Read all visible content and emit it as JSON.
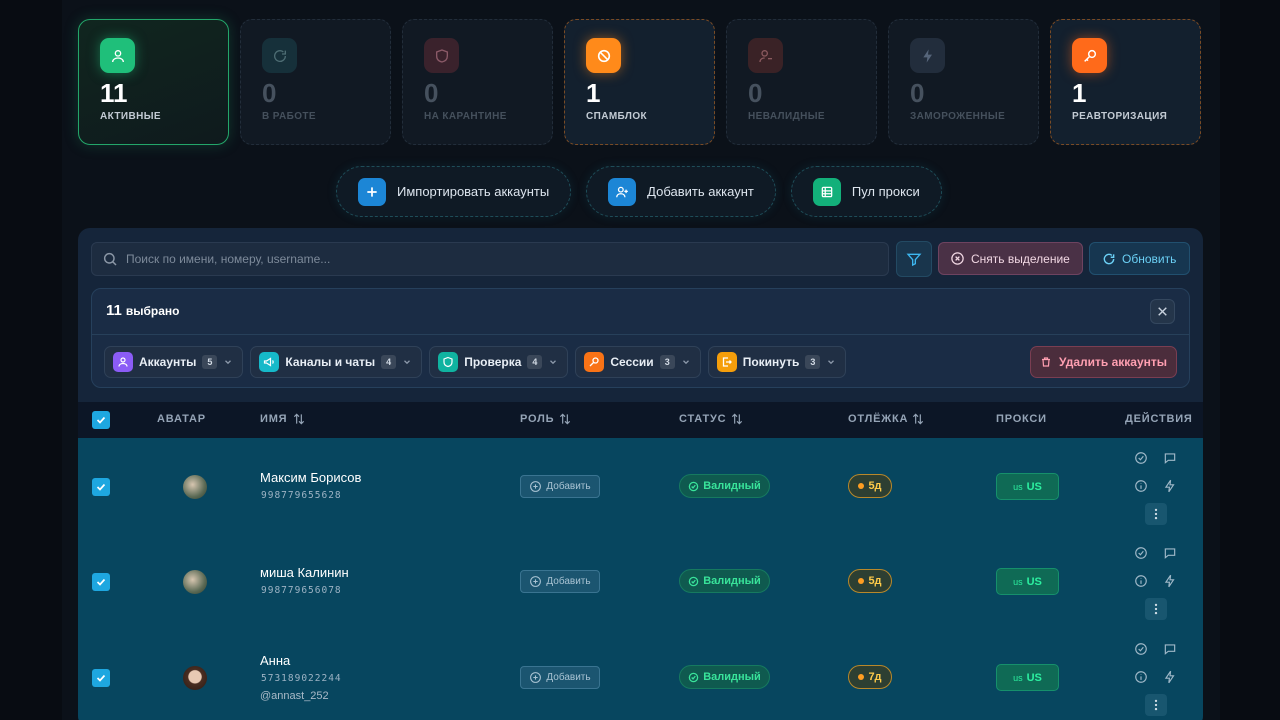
{
  "stats": [
    {
      "value": "11",
      "label": "АКТИВНЫЕ",
      "icon": "user-icon",
      "color": "#1fbf7a"
    },
    {
      "value": "0",
      "label": "В РАБОТЕ",
      "icon": "refresh-icon",
      "color": "#1b3a42"
    },
    {
      "value": "0",
      "label": "НА КАРАНТИНЕ",
      "icon": "shield-icon",
      "color": "#3c2530"
    },
    {
      "value": "1",
      "label": "СПАМБЛОК",
      "icon": "ban-icon",
      "color": "#ff8a1a"
    },
    {
      "value": "0",
      "label": "НЕВАЛИДНЫЕ",
      "icon": "user-minus-icon",
      "color": "#3c2427"
    },
    {
      "value": "0",
      "label": "ЗАМОРОЖЕННЫЕ",
      "icon": "bolt-icon",
      "color": "#253040"
    },
    {
      "value": "1",
      "label": "РЕАВТОРИЗАЦИЯ",
      "icon": "key-icon",
      "color": "#ff6a1a"
    }
  ],
  "actions": {
    "import": "Импортировать аккаунты",
    "add": "Добавить аккаунт",
    "proxy_pool": "Пул прокси"
  },
  "toolbar": {
    "search_placeholder": "Поиск по имени, номеру, username...",
    "deselect": "Снять выделение",
    "refresh": "Обновить"
  },
  "selection": {
    "count": "11",
    "label": "выбрано",
    "chips": [
      {
        "label": "Аккаунты",
        "count": "5",
        "icon": "users-icon",
        "color": "#8b5cf6"
      },
      {
        "label": "Каналы и чаты",
        "count": "4",
        "icon": "megaphone-icon",
        "color": "#16b9c9"
      },
      {
        "label": "Проверка",
        "count": "4",
        "icon": "shield-check-icon",
        "color": "#10b3a0"
      },
      {
        "label": "Сессии",
        "count": "3",
        "icon": "key-icon",
        "color": "#f97316"
      },
      {
        "label": "Покинуть",
        "count": "3",
        "icon": "exit-icon",
        "color": "#f59e0b"
      }
    ],
    "delete": "Удалить аккаунты"
  },
  "table": {
    "headers": {
      "avatar": "АВАТАР",
      "name": "ИМЯ",
      "role": "РОЛЬ",
      "status": "СТАТУС",
      "tracking": "ОТЛЁЖКА",
      "proxy": "ПРОКСИ",
      "actions": "ДЕЙСТВИЯ"
    },
    "rows": [
      {
        "name": "Максим Борисов",
        "phone": "998779655628",
        "username": "",
        "role": "Добавить",
        "status": "Валидный",
        "tracking": "5д",
        "proxy_code": "us",
        "proxy": "US"
      },
      {
        "name": "миша Калинин",
        "phone": "998779656078",
        "username": "",
        "role": "Добавить",
        "status": "Валидный",
        "tracking": "5д",
        "proxy_code": "us",
        "proxy": "US"
      },
      {
        "name": "Анна",
        "phone": "573189022244",
        "username": "@annast_252",
        "role": "Добавить",
        "status": "Валидный",
        "tracking": "7д",
        "proxy_code": "us",
        "proxy": "US"
      }
    ]
  }
}
